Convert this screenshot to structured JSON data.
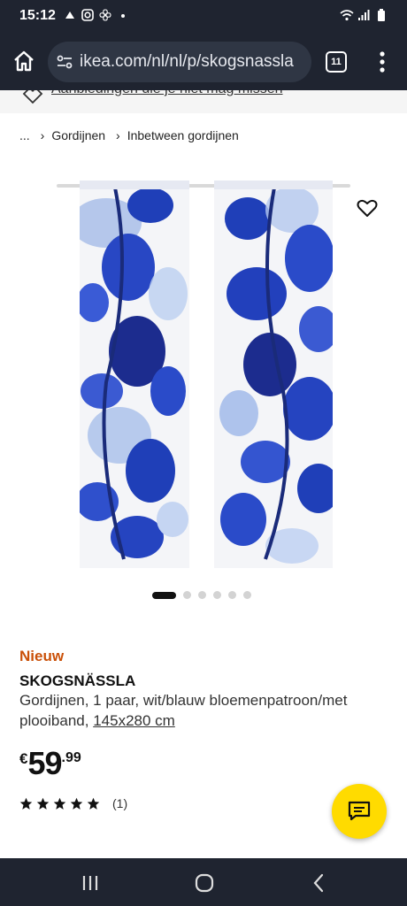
{
  "status_bar": {
    "time": "15:12",
    "left_icons": [
      "notification-icon",
      "instagram-icon",
      "fan-icon",
      "dot-icon"
    ],
    "right_icons": [
      "wifi-icon",
      "signal-icon",
      "battery-icon"
    ]
  },
  "browser": {
    "url": "ikea.com/nl/nl/p/skogsnassla",
    "tab_count": "11"
  },
  "promo": {
    "text": "Aanbiedingen die je niet mag missen"
  },
  "breadcrumb": {
    "items": [
      "...",
      "Gordijnen",
      "Inbetween gordijnen"
    ]
  },
  "carousel": {
    "total": 6,
    "active_index": 0
  },
  "product": {
    "badge": "Nieuw",
    "name": "SKOGSNÄSSLA",
    "description": "Gordijnen, 1 paar, wit/blauw bloemenpatroon/met plooiband,",
    "size": "145x280 cm",
    "price_currency": "€",
    "price_integer": "59",
    "price_decimal": ".99",
    "rating": 5,
    "rating_count": "(1)"
  },
  "colors": {
    "chrome": "#1f2430",
    "accent_yellow": "#ffdb00",
    "badge_orange": "#ca5008",
    "curtain_blue": "#2a4bc9"
  }
}
